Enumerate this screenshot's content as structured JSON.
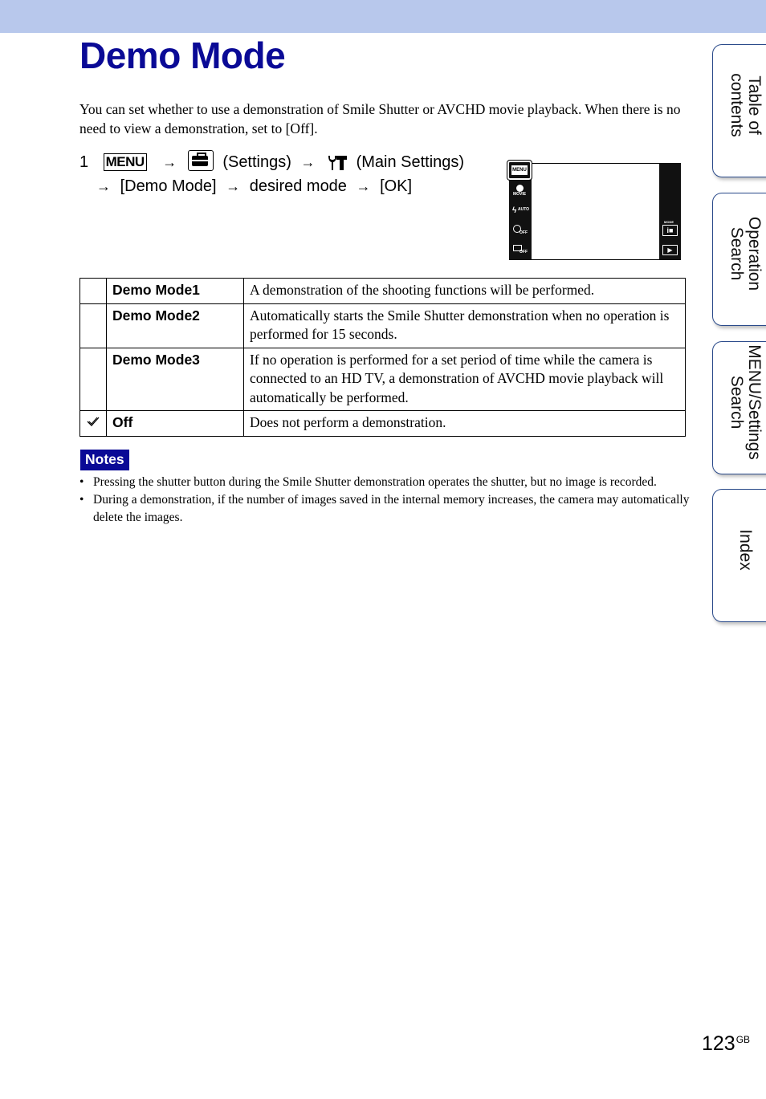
{
  "page": {
    "title": "Demo Mode",
    "intro": "You can set whether to use a demonstration of Smile Shutter or AVCHD movie playback. When there is no need to view a demonstration, set to [Off].",
    "page_number": "123",
    "page_suffix": "GB",
    "header_color": "#b8c8ec",
    "title_color": "#0a0a96"
  },
  "step": {
    "number": "1",
    "menu_label": "MENU",
    "arrow": "→",
    "settings_label": "(Settings)",
    "main_settings_label": "(Main Settings)",
    "demo_mode_label": "[Demo Mode]",
    "desired_mode_label": "desired mode",
    "ok_label": "[OK]",
    "icons": [
      "menu-icon",
      "settings-toolbox-icon",
      "main-settings-wrench-icon"
    ]
  },
  "lcd": {
    "menu_label": "MENU",
    "left_icons": [
      {
        "name": "movie-icon",
        "label": "MOVIE"
      },
      {
        "name": "flash-auto-icon",
        "label": "AUTO"
      },
      {
        "name": "self-timer-off-icon",
        "label": "OFF"
      },
      {
        "name": "burst-off-icon",
        "label": "OFF"
      }
    ],
    "right_icons": [
      {
        "name": "mode-intelligent-auto-icon",
        "label": "MODE"
      },
      {
        "name": "playback-icon",
        "label": ""
      }
    ]
  },
  "table": {
    "rows": [
      {
        "checked": false,
        "name": "Demo Mode1",
        "desc": "A demonstration of the shooting functions will be performed."
      },
      {
        "checked": false,
        "name": "Demo Mode2",
        "desc": "Automatically starts the Smile Shutter demonstration when no operation is performed for 15 seconds."
      },
      {
        "checked": false,
        "name": "Demo Mode3",
        "desc": "If no operation is performed for a set period of time while the camera is connected to an HD TV, a demonstration of AVCHD movie playback will automatically be performed."
      },
      {
        "checked": true,
        "name": "Off",
        "desc": "Does not perform a demonstration."
      }
    ]
  },
  "notes": {
    "label": "Notes",
    "bullet": "•",
    "items": [
      "Pressing the shutter button during the Smile Shutter demonstration operates the shutter, but no image is recorded.",
      "During a demonstration, if the number of images saved in the internal memory increases, the camera may automatically delete the images."
    ]
  },
  "side_tabs": [
    {
      "line1": "Table of",
      "line2": "contents"
    },
    {
      "line1": "Operation",
      "line2": "Search"
    },
    {
      "line1": "MENU/Settings",
      "line2": "Search"
    },
    {
      "line1": "Index",
      "line2": ""
    }
  ]
}
